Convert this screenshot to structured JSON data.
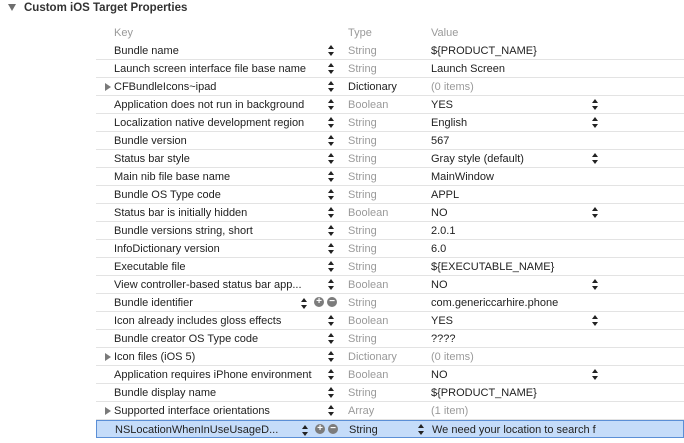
{
  "section": {
    "title": "Custom iOS Target Properties"
  },
  "columns": {
    "key": "Key",
    "type": "Type",
    "value": "Value"
  },
  "rows": [
    {
      "key": "Bundle name",
      "type": "String",
      "value": "${PRODUCT_NAME}",
      "expandable": false,
      "value_popup": false
    },
    {
      "key": "Launch screen interface file base name",
      "type": "String",
      "value": "Launch Screen",
      "expandable": false,
      "value_popup": false
    },
    {
      "key": "CFBundleIcons~ipad",
      "type": "Dictionary",
      "value": "(0 items)",
      "expandable": true,
      "value_popup": false
    },
    {
      "key": "Application does not run in background",
      "type": "Boolean",
      "value": "YES",
      "expandable": false,
      "value_popup": true
    },
    {
      "key": "Localization native development region",
      "type": "String",
      "value": "English",
      "expandable": false,
      "value_popup": true
    },
    {
      "key": "Bundle version",
      "type": "String",
      "value": "567",
      "expandable": false,
      "value_popup": false
    },
    {
      "key": "Status bar style",
      "type": "String",
      "value": "Gray style (default)",
      "expandable": false,
      "value_popup": true
    },
    {
      "key": "Main nib file base name",
      "type": "String",
      "value": "MainWindow",
      "expandable": false,
      "value_popup": false
    },
    {
      "key": "Bundle OS Type code",
      "type": "String",
      "value": "APPL",
      "expandable": false,
      "value_popup": false
    },
    {
      "key": "Status bar is initially hidden",
      "type": "Boolean",
      "value": "NO",
      "expandable": false,
      "value_popup": true
    },
    {
      "key": "Bundle versions string, short",
      "type": "String",
      "value": "2.0.1",
      "expandable": false,
      "value_popup": false
    },
    {
      "key": "InfoDictionary version",
      "type": "String",
      "value": "6.0",
      "expandable": false,
      "value_popup": false
    },
    {
      "key": "Executable file",
      "type": "String",
      "value": "${EXECUTABLE_NAME}",
      "expandable": false,
      "value_popup": false
    },
    {
      "key": "View controller-based status bar app...",
      "type": "Boolean",
      "value": "NO",
      "expandable": false,
      "value_popup": true
    },
    {
      "key": "Bundle identifier",
      "type": "String",
      "value": "com.genericcarhire.phone",
      "expandable": false,
      "value_popup": false,
      "has_add_remove": true
    },
    {
      "key": "Icon already includes gloss effects",
      "type": "Boolean",
      "value": "YES",
      "expandable": false,
      "value_popup": true
    },
    {
      "key": "Bundle creator OS Type code",
      "type": "String",
      "value": "????",
      "expandable": false,
      "value_popup": false
    },
    {
      "key": "Icon files (iOS 5)",
      "type": "Dictionary",
      "value": "(0 items)",
      "expandable": true,
      "value_popup": false
    },
    {
      "key": "Application requires iPhone environment",
      "type": "Boolean",
      "value": "NO",
      "expandable": false,
      "value_popup": true
    },
    {
      "key": "Bundle display name",
      "type": "String",
      "value": "${PRODUCT_NAME}",
      "expandable": false,
      "value_popup": false
    },
    {
      "key": "Supported interface orientations",
      "type": "Array",
      "value": "(1 item)",
      "expandable": true,
      "value_popup": false
    }
  ],
  "selected_row": {
    "key": "NSLocationWhenInUseUsageD...",
    "type": "String",
    "value": "We need your location to search f"
  }
}
